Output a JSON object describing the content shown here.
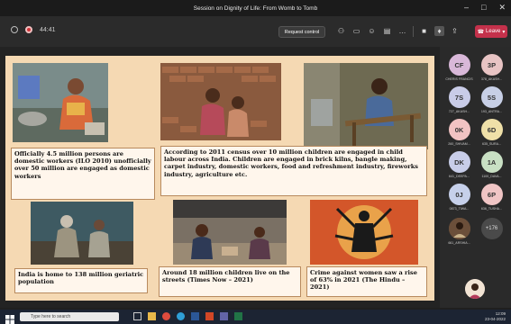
{
  "window": {
    "title": "Session on Dignity of Life: From Womb to Tomb",
    "controls": [
      "–",
      "□",
      "✕"
    ]
  },
  "toolbar": {
    "timer": "44:41",
    "request_control": "Request control",
    "leave_label": "Leave",
    "icons": [
      "people-icon",
      "chat-icon",
      "reactions-icon",
      "rooms-icon",
      "more-icon",
      "camera-icon",
      "mic-icon",
      "share-icon"
    ]
  },
  "slide": {
    "captions": [
      "Officially 4.5 million persons are domestic workers (ILO 2010) unofficially over 50 million are engaged as domestic workers",
      "According to 2011 census over 10 million children are engaged in child labour across India. Children are engaged in brick kilns, bangle making, carpet industry, domestic workers, food and refreshment industry, fireworks industry, agriculture etc.",
      "India is home to 138 million geriatric population",
      "Around 18 million children live on the streets (Times Now – 2021)",
      "Crime against women saw a rise of 63% in 2021 (The Hindu – 2021)"
    ]
  },
  "participants": [
    {
      "initials": "CF",
      "name": "CHERIS FRANCIS",
      "color": "#d9b8d9"
    },
    {
      "initials": "3P",
      "name": "378_AKASH...",
      "color": "#e8c4c4"
    },
    {
      "initials": "7S",
      "name": "727_AKASH...",
      "color": "#c9cce8"
    },
    {
      "initials": "5S",
      "name": "193_ANTRA...",
      "color": "#c7cfe6"
    },
    {
      "initials": "0K",
      "name": "260_SHIVAM...",
      "color": "#f2c3c3"
    },
    {
      "initials": "6D",
      "name": "635_SURA...",
      "color": "#efe0a8"
    },
    {
      "initials": "DK",
      "name": "641_DEEPA...",
      "color": "#c8cde8"
    },
    {
      "initials": "1A",
      "name": "1100_DAVA...",
      "color": "#c9e0c4"
    },
    {
      "initials": "0J",
      "name": "0873_TIWA...",
      "color": "#c6d0ea"
    },
    {
      "initials": "6P",
      "name": "636_TUSHA...",
      "color": "#f0c5c5"
    },
    {
      "initials": "",
      "name": "661_ARSHIA...",
      "color": "#6b4f3a"
    },
    {
      "initials": "+176",
      "name": "",
      "color": "#4a4a4a"
    }
  ],
  "name_strip": "CHERIS FRANCIS",
  "taskbar": {
    "search_placeholder": "Type here to search",
    "time": "12:09",
    "date": "23-04-2022"
  }
}
